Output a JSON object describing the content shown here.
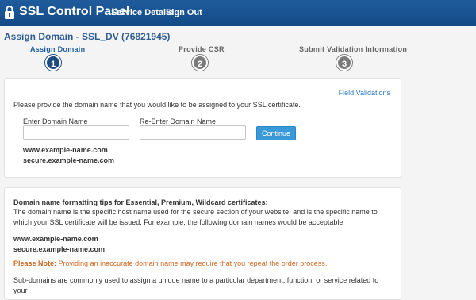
{
  "header": {
    "app_title": "SSL Control Panel",
    "nav": {
      "service_details": "Service Details",
      "sign_out": "Sign Out"
    },
    "background_color": "#1a5491"
  },
  "page": {
    "title": "Assign Domain - SSL_DV (76821945)"
  },
  "steps": [
    {
      "label": "Assign Domain",
      "number": "1",
      "state": "active"
    },
    {
      "label": "Provide CSR",
      "number": "2",
      "state": "inactive"
    },
    {
      "label": "Submit Validation Information",
      "number": "3",
      "state": "inactive"
    }
  ],
  "domain_form": {
    "field_validations_link": "Field Validations",
    "instruction": "Please provide the domain name that you would like to be assigned to your SSL certificate.",
    "enter_label": "Enter Domain Name",
    "enter_value": "",
    "reenter_label": "Re-Enter Domain Name",
    "reenter_value": "",
    "continue_button": "Continue",
    "examples": [
      "www.example-name.com",
      "secure.example-name.com"
    ]
  },
  "tips": {
    "heading": "Domain name formatting tips for Essential, Premium, Wildcard certificates:",
    "body": "The domain name is the specific host name used for the secure section of your website, and is the specific name to which your SSL certificate will be issued. For example, the following domain names would be acceptable:",
    "examples": [
      "www.example-name.com",
      "secure.example-name.com"
    ],
    "note_label": "Please Note:",
    "note_text": "Providing an inaccurate domain name may require that you repeat the order process.",
    "subdomains": "Sub-domains are commonly used to assign a unique name to a particular department, function, or service related to your"
  },
  "colors": {
    "accent": "#1e5f9c",
    "button": "#3a9ad9",
    "link": "#2a7bc4",
    "note": "#d0661f"
  }
}
